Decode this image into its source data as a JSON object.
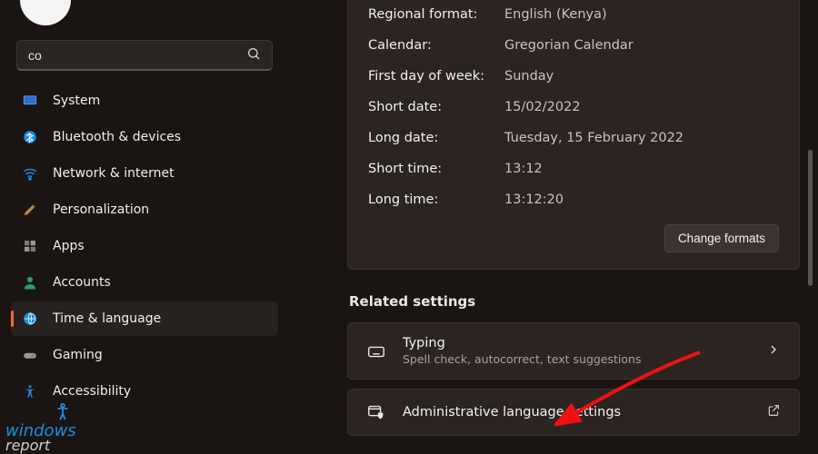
{
  "search": {
    "value": "co"
  },
  "sidebar": {
    "items": [
      {
        "label": "System"
      },
      {
        "label": "Bluetooth & devices"
      },
      {
        "label": "Network & internet"
      },
      {
        "label": "Personalization"
      },
      {
        "label": "Apps"
      },
      {
        "label": "Accounts"
      },
      {
        "label": "Time & language"
      },
      {
        "label": "Gaming"
      },
      {
        "label": "Accessibility"
      }
    ]
  },
  "regional": {
    "rows": [
      {
        "k": "Regional format:",
        "v": "English (Kenya)"
      },
      {
        "k": "Calendar:",
        "v": "Gregorian Calendar"
      },
      {
        "k": "First day of week:",
        "v": "Sunday"
      },
      {
        "k": "Short date:",
        "v": "15/02/2022"
      },
      {
        "k": "Long date:",
        "v": "Tuesday, 15 February 2022"
      },
      {
        "k": "Short time:",
        "v": "13:12"
      },
      {
        "k": "Long time:",
        "v": "13:12:20"
      }
    ],
    "change_formats": "Change formats"
  },
  "related": {
    "title": "Related settings",
    "typing": {
      "title": "Typing",
      "sub": "Spell check, autocorrect, text suggestions"
    },
    "admin": {
      "title": "Administrative language settings"
    }
  },
  "watermark": {
    "line1": "windows",
    "line2": "report"
  }
}
